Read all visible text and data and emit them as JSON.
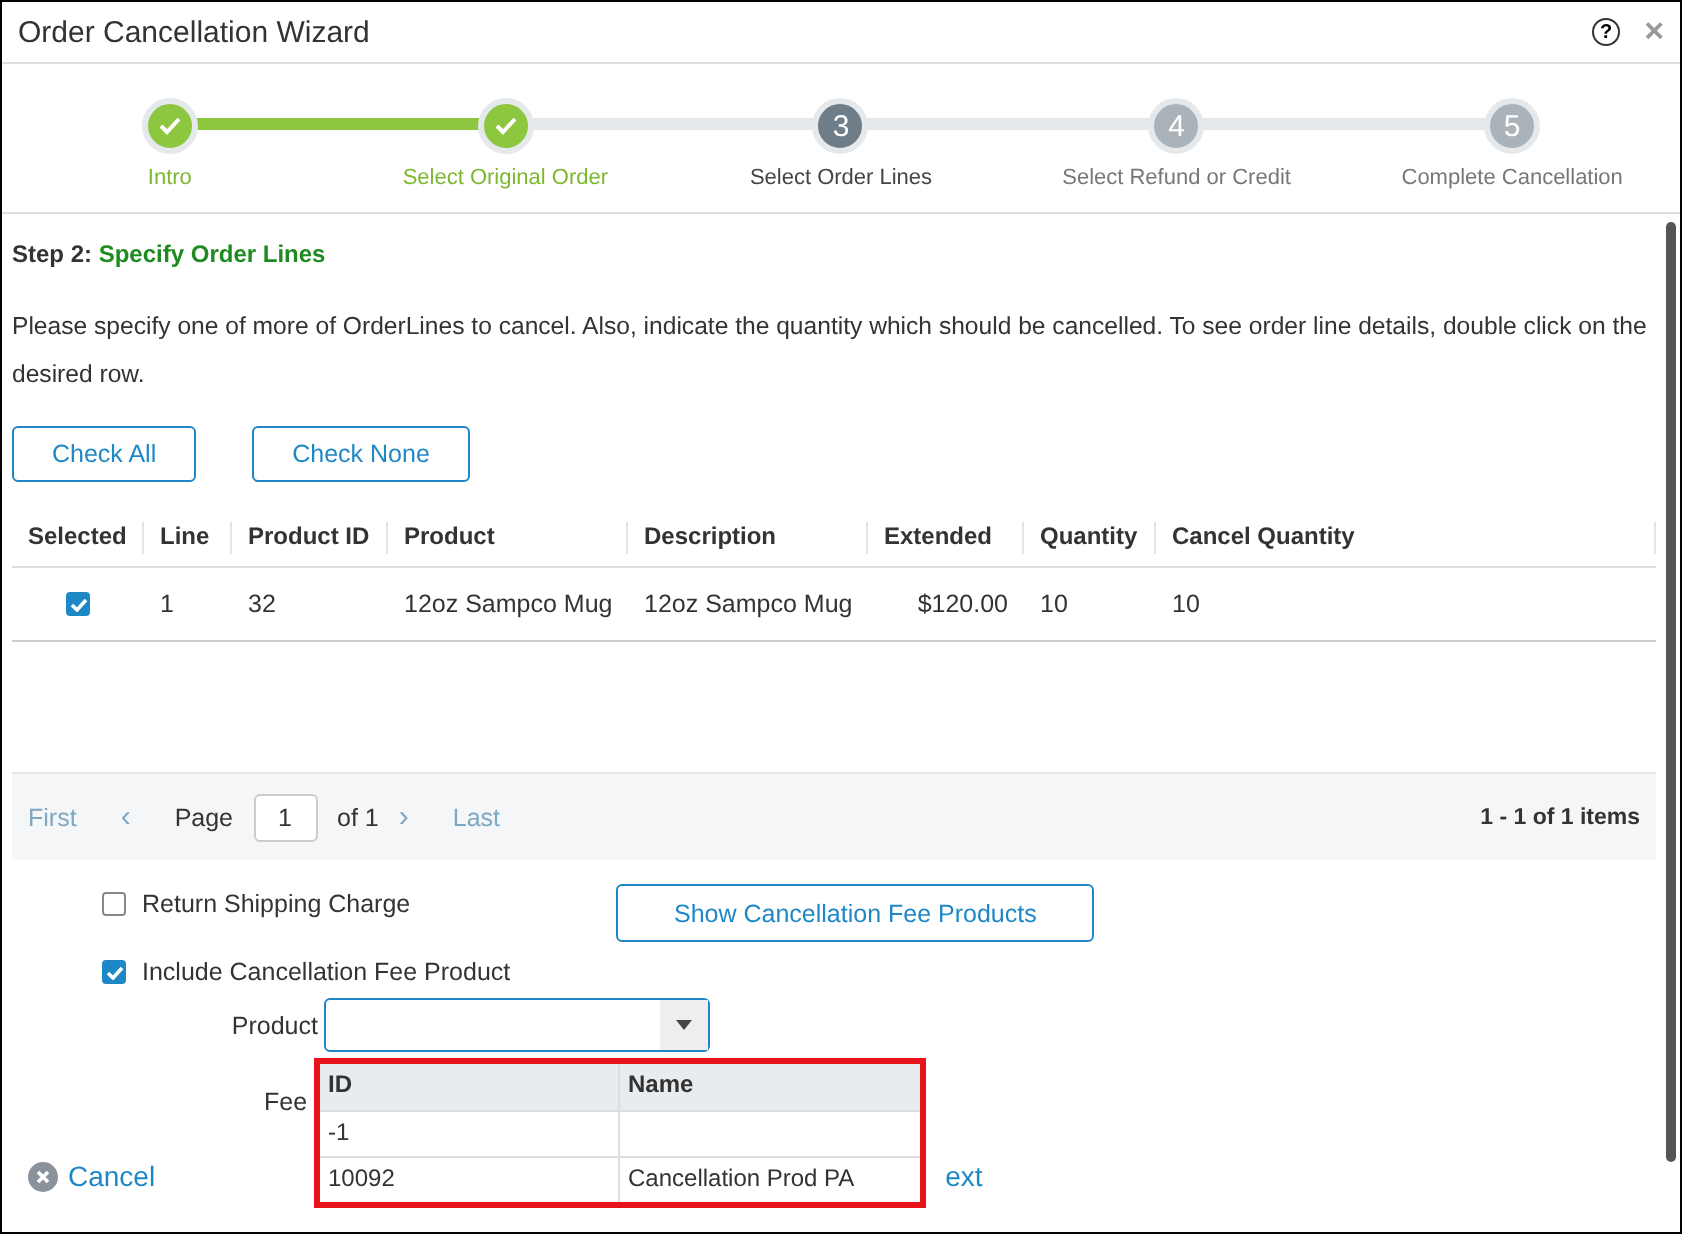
{
  "window": {
    "title": "Order Cancellation Wizard",
    "help": "?",
    "close": "×"
  },
  "steps": [
    {
      "label": "Intro",
      "done": true,
      "selected": false
    },
    {
      "label": "Select Original Order",
      "done": true,
      "selected": false
    },
    {
      "number": "3",
      "label": "Select Order Lines",
      "done": false,
      "selected": true
    },
    {
      "number": "4",
      "label": "Select Refund or Credit",
      "done": false,
      "selected": false
    },
    {
      "number": "5",
      "label": "Complete Cancellation",
      "done": false,
      "selected": false
    }
  ],
  "step_heading": {
    "prefix": "Step 2:",
    "title": "Specify Order Lines"
  },
  "instructions": "Please specify one of more of OrderLines to cancel. Also, indicate the quantity which should be cancelled. To see order line details, double click on the desired row.",
  "buttons": [
    "Check All",
    "Check None"
  ],
  "table": {
    "columns": [
      "Selected",
      "Line",
      "Product ID",
      "Product",
      "Description",
      "Extended",
      "Quantity",
      "Cancel Quantity"
    ],
    "rows": [
      {
        "checked": true,
        "cells": [
          "",
          "1",
          "32",
          "12oz Sampco Mug",
          "12oz Sampco Mug",
          "$120.00",
          "10",
          "10"
        ]
      }
    ]
  },
  "pager": {
    "first": "First",
    "prev": "‹",
    "page_label": "Page",
    "page": "1",
    "of": "of 1",
    "next": "›",
    "last": "Last",
    "summary": "1 - 1 of 1 items"
  },
  "options": [
    {
      "label": "Return Shipping Charge",
      "checked": false
    },
    {
      "label": "Include Cancellation Fee Product",
      "checked": true
    }
  ],
  "show_fees_button": "Show Cancellation Fee Products",
  "product_field": {
    "label": "Product"
  },
  "fee_label": "Fee",
  "dropdown": {
    "columns": [
      "ID",
      "Name"
    ],
    "rows": [
      [
        "-1",
        ""
      ],
      [
        "10092",
        "Cancellation Prod PA"
      ]
    ]
  },
  "footer": {
    "cancel": "Cancel",
    "next": "ext"
  }
}
